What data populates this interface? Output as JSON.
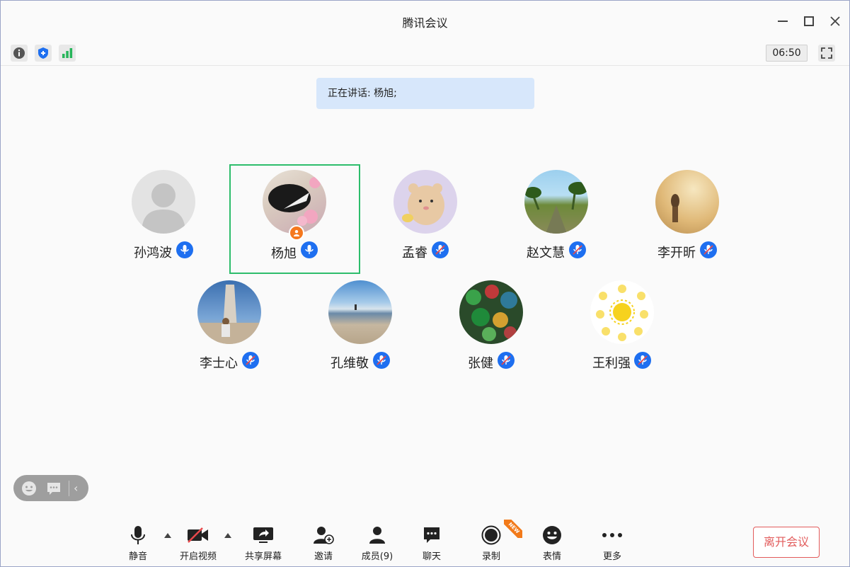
{
  "window": {
    "title": "腾讯会议"
  },
  "toolbar": {
    "timer": "06:50"
  },
  "speaking_banner": {
    "text": "正在讲话: 杨旭;"
  },
  "participants": [
    {
      "name": "孙鸿波",
      "mic": "on",
      "avatar": "default-silhouette"
    },
    {
      "name": "杨旭",
      "mic": "on",
      "avatar": "photo",
      "active_speaker": true,
      "host": true
    },
    {
      "name": "孟睿",
      "mic": "muted",
      "avatar": "cartoon-bear"
    },
    {
      "name": "赵文慧",
      "mic": "muted",
      "avatar": "photo-palm-road"
    },
    {
      "name": "李开昕",
      "mic": "muted",
      "avatar": "photo-sepia"
    },
    {
      "name": "李士心",
      "mic": "muted",
      "avatar": "photo-statue"
    },
    {
      "name": "孔维敬",
      "mic": "muted",
      "avatar": "photo-beach"
    },
    {
      "name": "张健",
      "mic": "muted",
      "avatar": "photo-marbles"
    },
    {
      "name": "王利强",
      "mic": "muted",
      "avatar": "suns-pattern"
    }
  ],
  "bottom_bar": {
    "mute": "静音",
    "video": "开启视频",
    "share": "共享屏幕",
    "invite": "邀请",
    "members": "成员(9)",
    "chat": "聊天",
    "record": "录制",
    "reaction": "表情",
    "more": "更多",
    "new_badge": "NEW",
    "leave": "离开会议"
  },
  "colors": {
    "accent_blue": "#1e6ff0",
    "active_border": "#2dbd6b",
    "leave_red": "#e25b5b",
    "banner_bg": "#d7e7fb",
    "host_orange": "#f5781e"
  }
}
